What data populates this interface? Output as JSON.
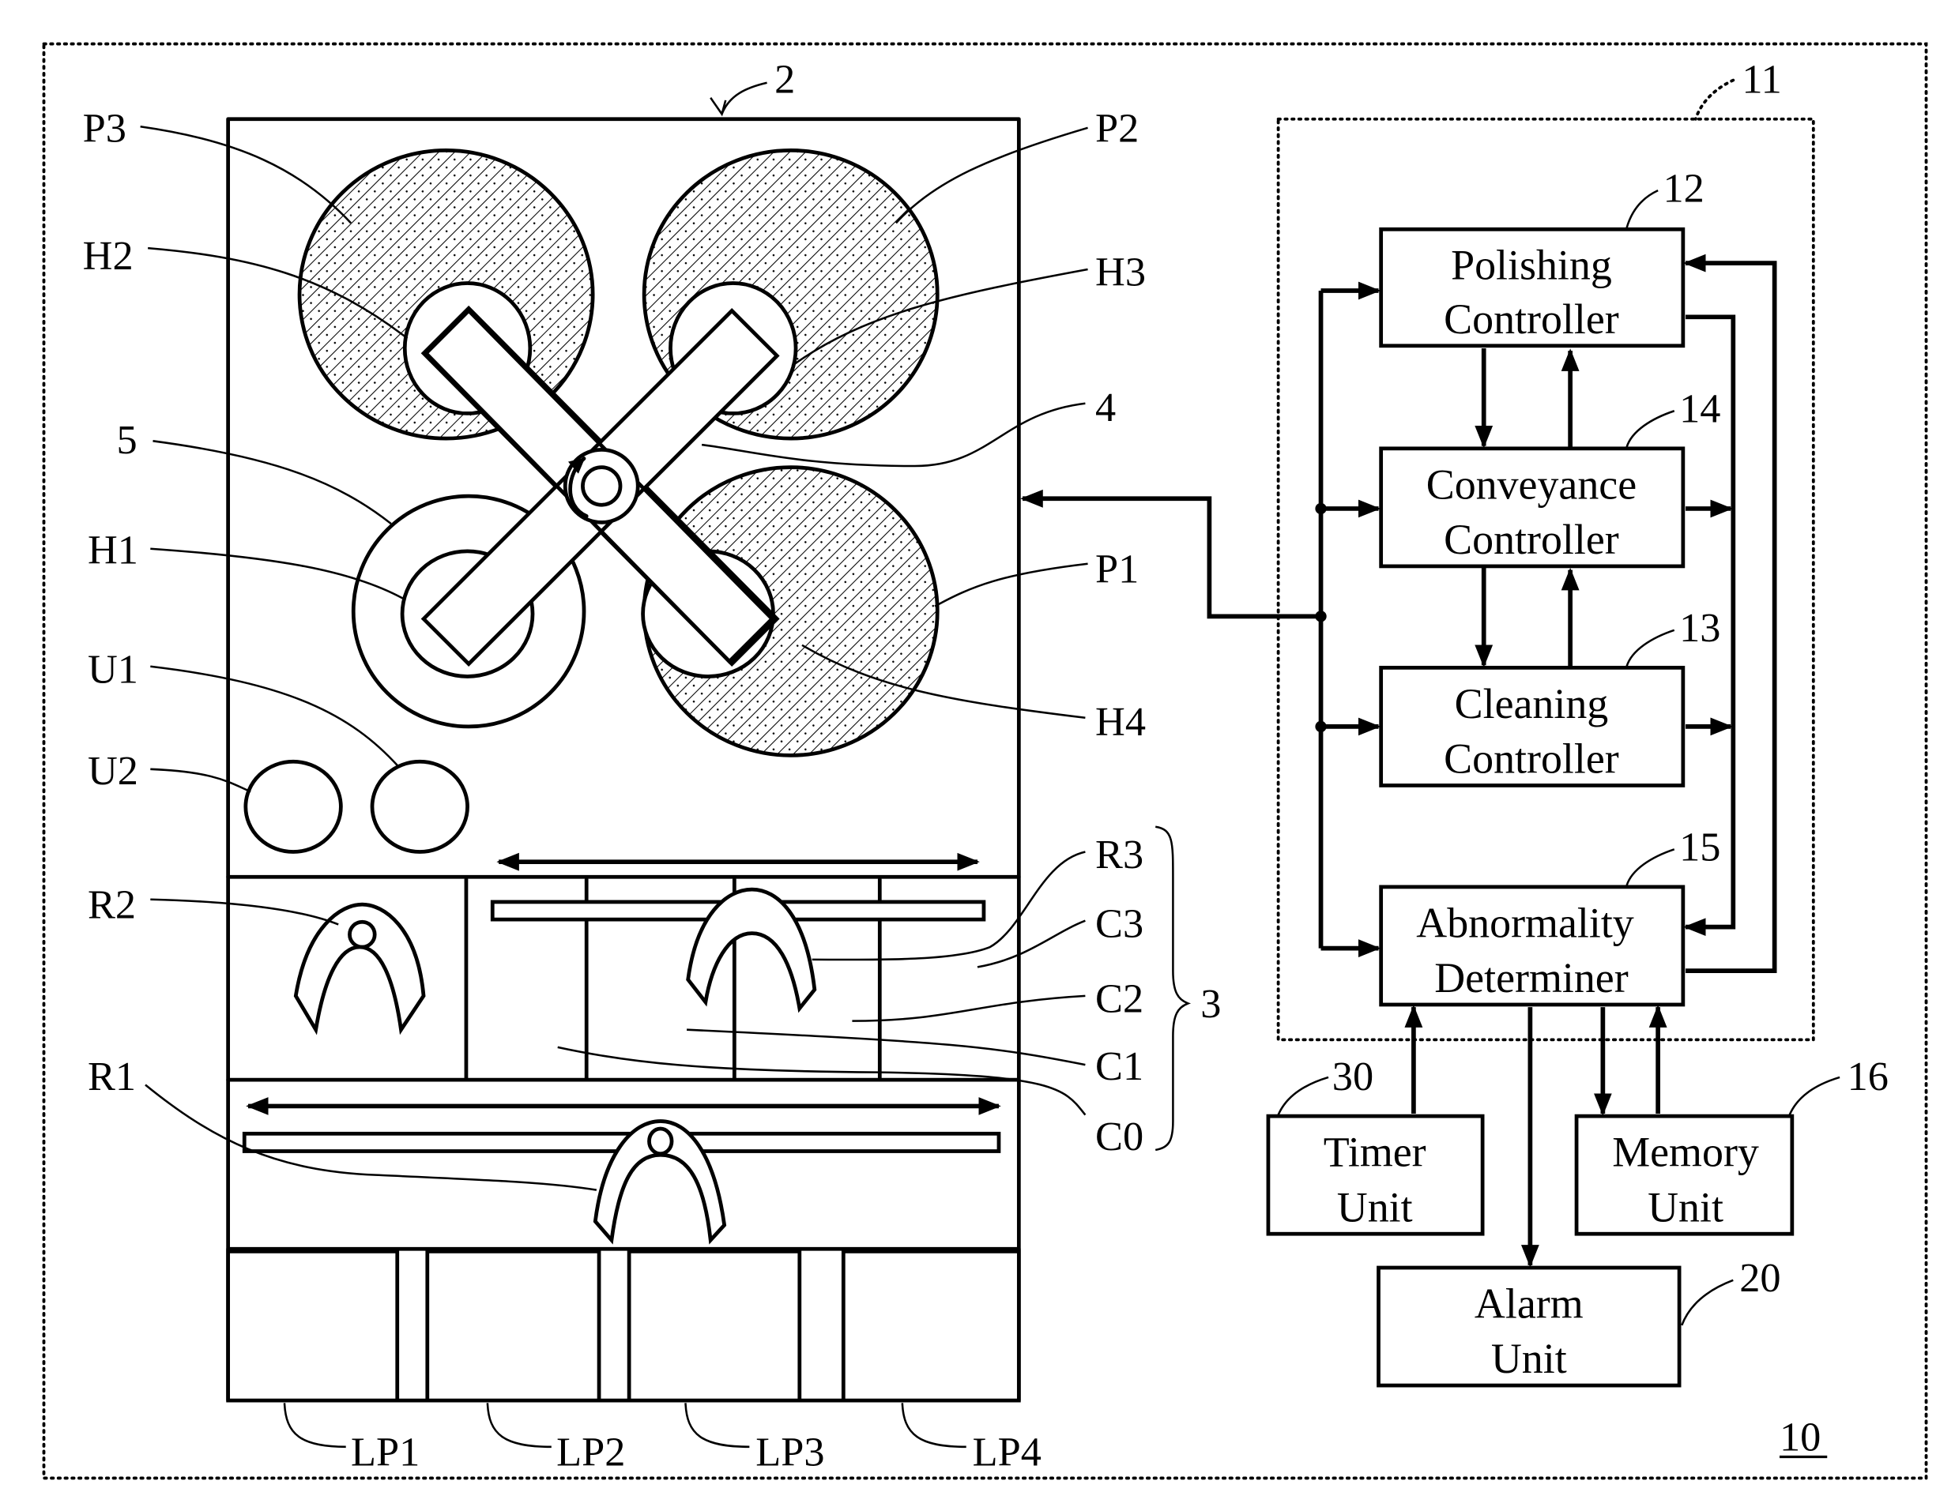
{
  "figure": {
    "figure_number_label": "10",
    "machine_label": "2",
    "controller_group_label": "11",
    "cleaning_section_label": "3",
    "turntable_label": "4",
    "load_unload_table_label": "5"
  },
  "machine": {
    "polishing_tables": [
      {
        "label": "P1"
      },
      {
        "label": "P2"
      },
      {
        "label": "P3"
      }
    ],
    "polishing_heads": [
      {
        "label": "H1"
      },
      {
        "label": "H2"
      },
      {
        "label": "H3"
      },
      {
        "label": "H4"
      }
    ],
    "units": [
      {
        "label": "U1"
      },
      {
        "label": "U2"
      }
    ],
    "robots": [
      {
        "label": "R1"
      },
      {
        "label": "R2"
      },
      {
        "label": "R3"
      }
    ],
    "cleaning_chambers": [
      {
        "label": "C0"
      },
      {
        "label": "C1"
      },
      {
        "label": "C2"
      },
      {
        "label": "C3"
      }
    ],
    "load_ports": [
      {
        "label": "LP1"
      },
      {
        "label": "LP2"
      },
      {
        "label": "LP3"
      },
      {
        "label": "LP4"
      }
    ]
  },
  "blocks": {
    "polishing": {
      "ref": "12",
      "line1": "Polishing",
      "line2": "Controller"
    },
    "conveyance": {
      "ref": "14",
      "line1": "Conveyance",
      "line2": "Controller"
    },
    "cleaning": {
      "ref": "13",
      "line1": "Cleaning",
      "line2": "Controller"
    },
    "abnormality": {
      "ref": "15",
      "line1": "Abnormality",
      "line2": "Determiner"
    },
    "timer": {
      "ref": "30",
      "line1": "Timer",
      "line2": "Unit"
    },
    "memory": {
      "ref": "16",
      "line1": "Memory",
      "line2": "Unit"
    },
    "alarm": {
      "ref": "20",
      "line1": "Alarm",
      "line2": "Unit"
    }
  }
}
